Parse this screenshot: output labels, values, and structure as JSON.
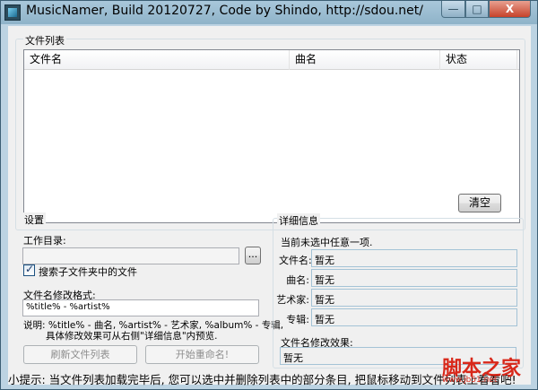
{
  "window": {
    "title": "MusicNamer, Build 20120727, Code by Shindo, http://sdou.net/",
    "min_label": "—",
    "max_label": "□",
    "close_label": "X"
  },
  "file_list": {
    "group_title": "文件列表",
    "columns": [
      "文件名",
      "曲名",
      "状态"
    ],
    "clear_label": "清空"
  },
  "settings": {
    "group_title": "设置",
    "work_dir_label": "工作目录:",
    "work_dir_value": "",
    "browse_label": "...",
    "search_subfolders_label": "搜索子文件夹中的文件",
    "format_label": "文件名修改格式:",
    "format_value": "%title% - %artist%",
    "explain_line1": "说明: %title% - 曲名, %artist% - 艺术家, %album% - 专辑,",
    "explain_line2": "具体修改效果可从右侧\"详细信息\"内预览.",
    "refresh_label": "刷新文件列表",
    "rename_label": "开始重命名!"
  },
  "details": {
    "group_title": "详细信息",
    "status_line": "当前未选中任意一项.",
    "rows": [
      {
        "label": "文件名:",
        "value": "暂无"
      },
      {
        "label": "曲名:",
        "value": "暂无"
      },
      {
        "label": "艺术家:",
        "value": "暂无"
      },
      {
        "label": "专辑:",
        "value": "暂无"
      }
    ],
    "effect_label": "文件名修改效果:",
    "effect_value": "暂无"
  },
  "hint": "小提示: 当文件列表加载完毕后, 您可以选中并删除列表中的部分条目, 把鼠标移动到文件列表上看看吧!",
  "watermark": {
    "main": "脚本之家",
    "sub": "www.jb51.net"
  }
}
